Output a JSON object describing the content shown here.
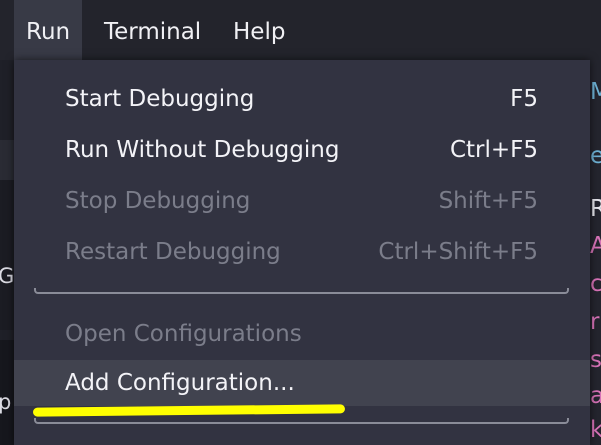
{
  "menubar": {
    "items": [
      {
        "label": "Run",
        "active": true
      },
      {
        "label": "Terminal",
        "active": false
      },
      {
        "label": "Help",
        "active": false
      }
    ]
  },
  "run_menu": {
    "group1": [
      {
        "label": "Start Debugging",
        "shortcut": "F5",
        "enabled": true
      },
      {
        "label": "Run Without Debugging",
        "shortcut": "Ctrl+F5",
        "enabled": true
      },
      {
        "label": "Stop Debugging",
        "shortcut": "Shift+F5",
        "enabled": false
      },
      {
        "label": "Restart Debugging",
        "shortcut": "Ctrl+Shift+F5",
        "enabled": false
      }
    ],
    "group2": [
      {
        "label": "Open Configurations",
        "enabled": false
      },
      {
        "label": "Add Configuration...",
        "enabled": true,
        "highlighted": true
      }
    ]
  },
  "background": {
    "left_fragments": [
      "Go",
      "p"
    ],
    "right_fragments": [
      {
        "text": "M",
        "color": "#6fb3d6"
      },
      {
        "text": "e",
        "color": "#6fb3d6"
      },
      {
        "text": "R",
        "color": "#e8e8ee"
      },
      {
        "text": "A",
        "color": "#d873b8"
      },
      {
        "text": "c",
        "color": "#d873b8"
      },
      {
        "text": "r",
        "color": "#d873b8"
      },
      {
        "text": "s",
        "color": "#d873b8"
      },
      {
        "text": "a",
        "color": "#d873b8"
      },
      {
        "text": "k",
        "color": "#d873b8"
      }
    ]
  },
  "colors": {
    "menu_bg": "#323341",
    "highlight_bg": "#41434f",
    "annotation": "#ffff00"
  }
}
